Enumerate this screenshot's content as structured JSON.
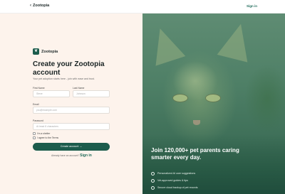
{
  "topbar": {
    "back_label": "Zootopia",
    "signin_label": "Sign in"
  },
  "brand": {
    "name": "Zootopia",
    "logo_glyph": "❦"
  },
  "form": {
    "title": "Create your Zootopia account",
    "subtitle": "Your pet adoption starts here - join with ease and trust.",
    "first_name": {
      "label": "First Name",
      "placeholder": "Steve"
    },
    "last_name": {
      "label": "Last Name",
      "placeholder": "Johnson"
    },
    "email": {
      "label": "Email",
      "placeholder": "you@example.com"
    },
    "password": {
      "label": "Password",
      "placeholder": "At least 8 characters"
    },
    "checks": [
      {
        "label": "I'm a shelter",
        "checked": false
      },
      {
        "label": "I agree to the Terms",
        "checked": false
      }
    ],
    "submit_label": "Create account →",
    "login_prompt": "Already have an account?",
    "login_link": "Sign in"
  },
  "hero": {
    "title": "Join 120,000+ pet parents caring smarter every day.",
    "bullets": [
      "Personalized AI care suggestions",
      "Vet-approved guides & tips",
      "Secure cloud backup of pet records"
    ]
  },
  "colors": {
    "accent": "#1c5c4c",
    "left_bg": "#fdf3ec",
    "right_bg": "#3d6e58"
  }
}
